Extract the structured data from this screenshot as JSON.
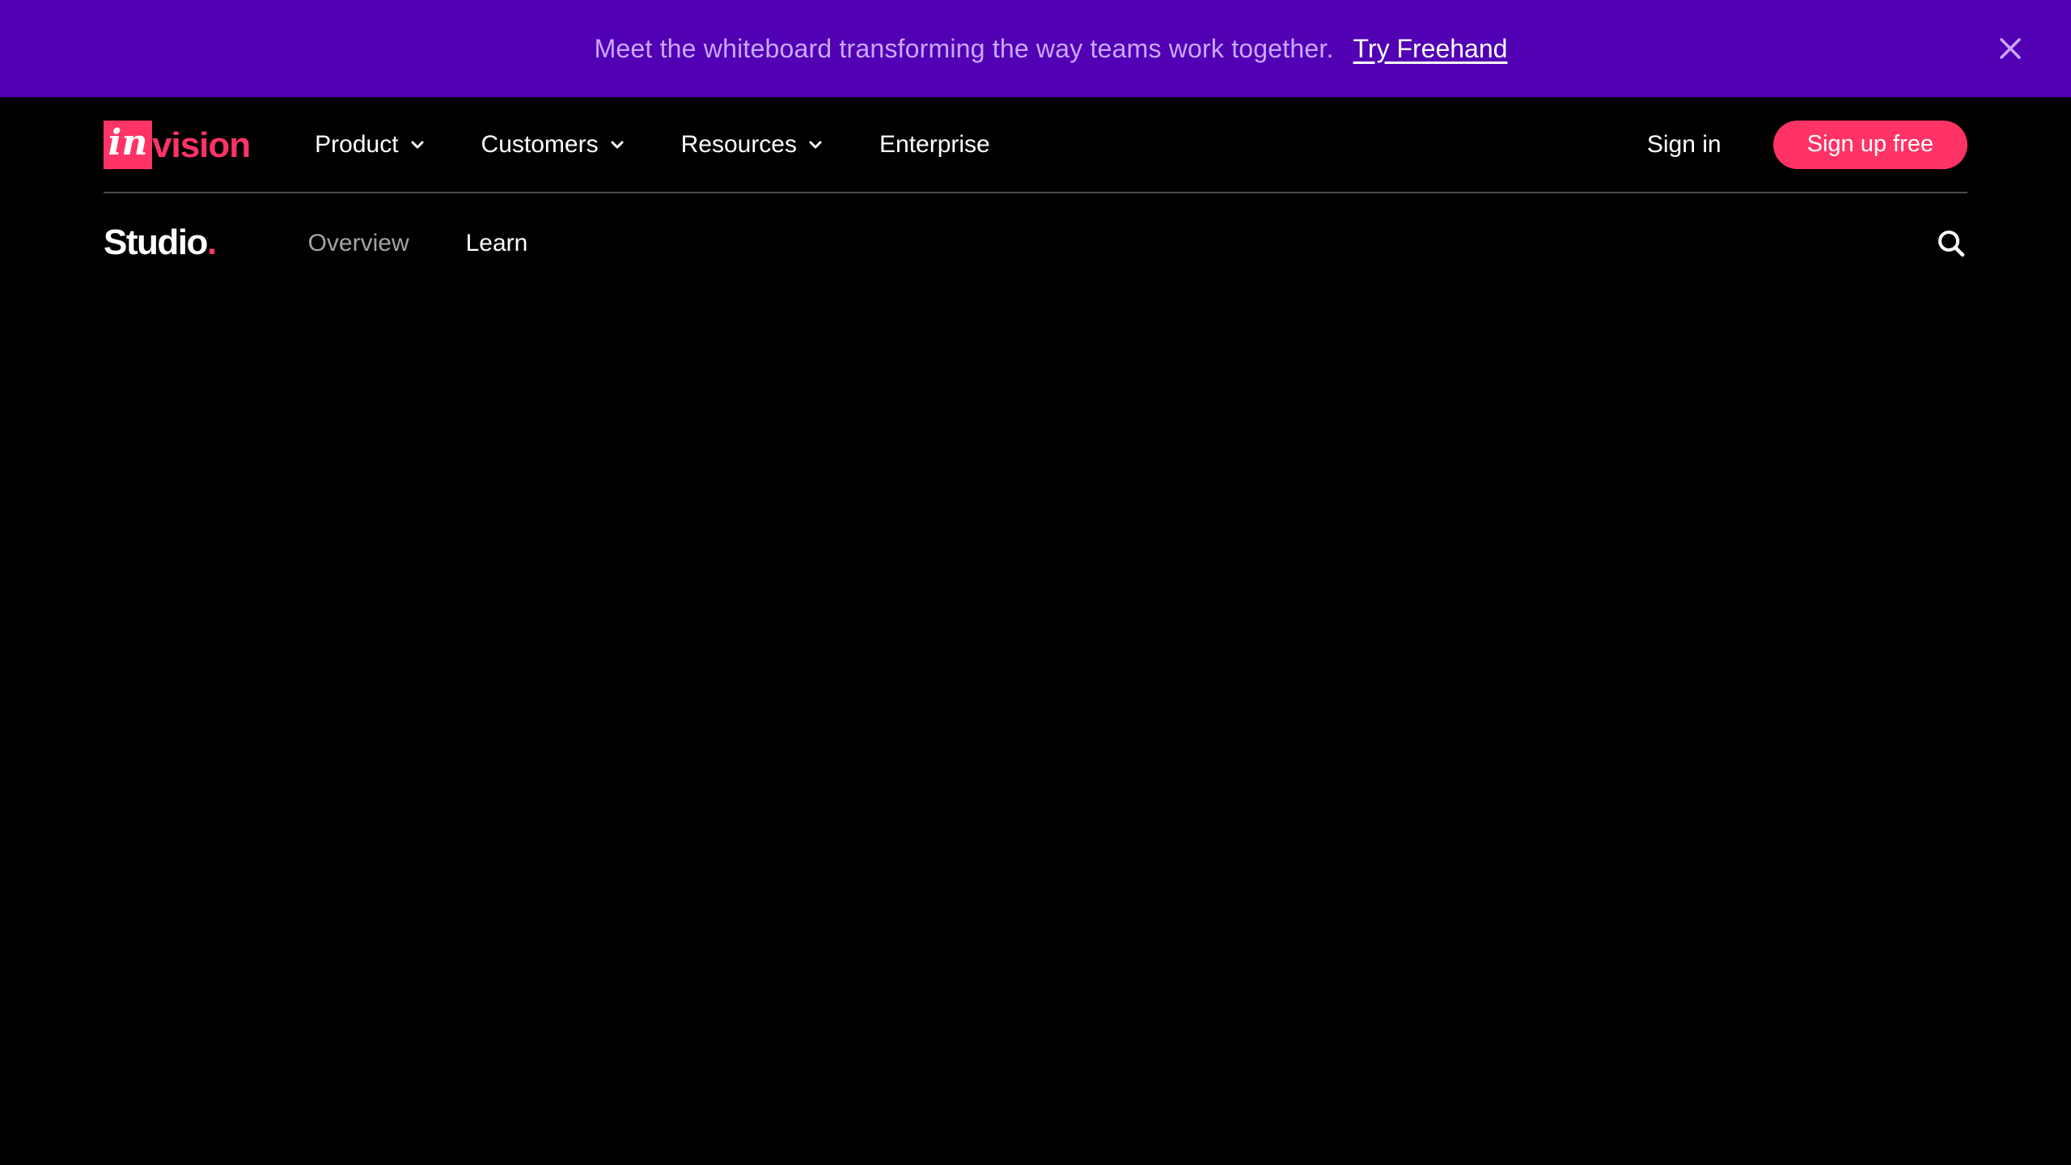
{
  "banner": {
    "text": "Meet the whiteboard transforming the way teams work together.",
    "link_label": "Try Freehand",
    "close_icon": "close-icon",
    "background": "#5200b4"
  },
  "header": {
    "logo": {
      "prefix": "in",
      "suffix": "vision",
      "color": "#ff3366"
    },
    "nav": [
      {
        "label": "Product",
        "icon": "chevron-down-icon"
      },
      {
        "label": "Customers",
        "icon": "chevron-down-icon"
      },
      {
        "label": "Resources",
        "icon": "chevron-down-icon"
      },
      {
        "label": "Enterprise"
      }
    ],
    "sign_in_label": "Sign in",
    "sign_up_label": "Sign up free",
    "accent": "#ff3366"
  },
  "subheader": {
    "logo_text": "Studio",
    "logo_dot": ".",
    "nav": [
      {
        "label": "Overview",
        "state": "inactive"
      },
      {
        "label": "Learn",
        "state": "active"
      }
    ],
    "search_icon": "search-icon"
  }
}
